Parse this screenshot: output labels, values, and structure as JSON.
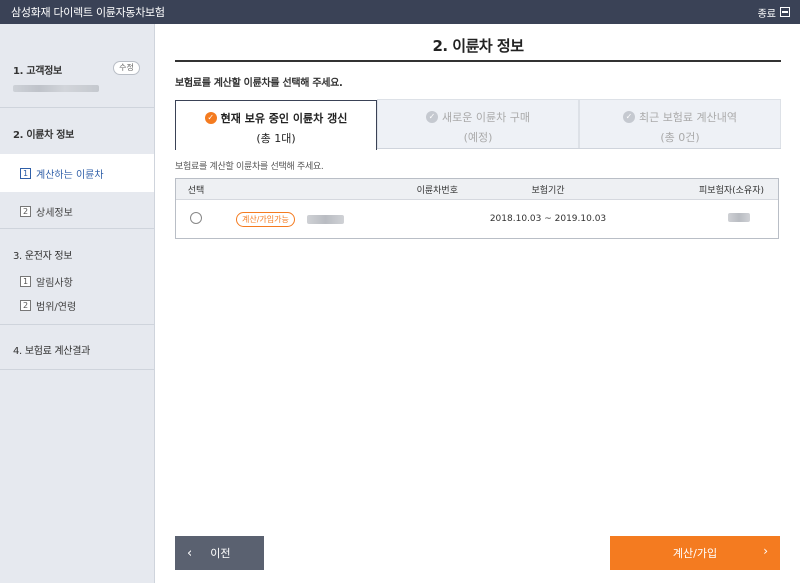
{
  "header": {
    "title": "삼성화재 다이렉트 이륜자동차보험",
    "exit_label": "종료"
  },
  "sidebar": {
    "sections": [
      {
        "title": "1. 고객정보",
        "edit_label": "수정"
      },
      {
        "title": "2. 이륜차 정보",
        "items": [
          {
            "num": "1",
            "label": "계산하는 이륜차"
          },
          {
            "num": "2",
            "label": "상세정보"
          }
        ]
      },
      {
        "title": "3. 운전자 정보",
        "items": [
          {
            "num": "1",
            "label": "알림사항"
          },
          {
            "num": "2",
            "label": "범위/연령"
          }
        ]
      },
      {
        "title": "4. 보험료 계산결과"
      }
    ]
  },
  "main": {
    "title": "2. 이륜차 정보",
    "instruction": "보험료를 계산할 이륜차를 선택해 주세요.",
    "tabs": [
      {
        "label": "현재 보유 중인 이륜차 갱신",
        "sub": "(총 1대)",
        "active": true
      },
      {
        "label": "새로운 이륜차 구매",
        "sub": "(예정)",
        "active": false
      },
      {
        "label": "최근 보험료 계산내역",
        "sub": "(총 0건)",
        "active": false
      }
    ],
    "sub_instruction": "보험료를 계산할 이륜차를 선택해 주세요.",
    "table": {
      "headers": {
        "select": "선택",
        "plate": "이륜차번호",
        "period": "보험기간",
        "owner": "피보험자(소유자)"
      },
      "rows": [
        {
          "badge": "계산/가입가능",
          "period": "2018.10.03 ~ 2019.10.03"
        }
      ]
    },
    "buttons": {
      "prev": "이전",
      "next": "계산/가입"
    }
  },
  "colors": {
    "header_bg": "#3a4256",
    "accent": "#f47b20",
    "sidebar_bg": "#e6e9ef",
    "prev_btn": "#5a6170"
  }
}
